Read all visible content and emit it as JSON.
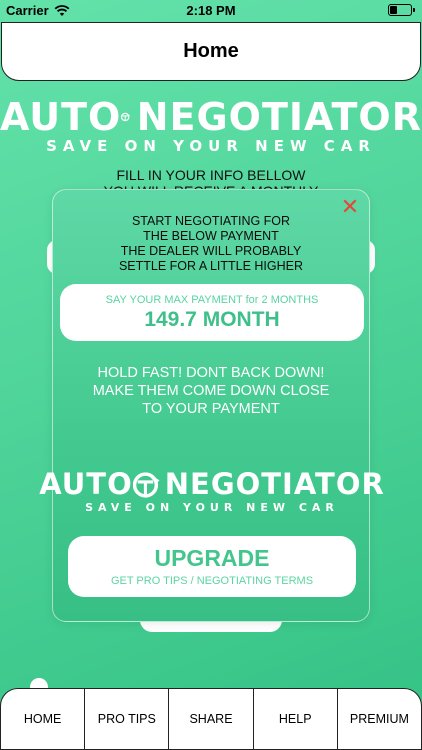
{
  "status_bar": {
    "carrier": "Carrier",
    "time": "2:18 PM"
  },
  "nav": {
    "title": "Home"
  },
  "logo": {
    "brand_part1": "AUTO",
    "brand_part2": "NEGOTIATOR",
    "tagline": "SAVE ON YOUR NEW CAR"
  },
  "background": {
    "line1": "FILL IN YOUR INFO BELLOW",
    "line2": "YOU WILL RECEIVE A MONTHLY"
  },
  "popup": {
    "close_label": "✕",
    "instructions": [
      "START NEGOTIATING FOR",
      "THE BELOW PAYMENT",
      "THE DEALER WILL PROBABLY",
      "SETTLE FOR A LITTLE HIGHER"
    ],
    "payment_label": "SAY YOUR MAX PAYMENT for 2 MONTHS",
    "payment_value": "149.7 MONTH",
    "hold_text": [
      "HOLD FAST! DONT BACK DOWN!",
      "MAKE THEM COME DOWN CLOSE",
      "TO YOUR PAYMENT"
    ],
    "upgrade_title": "UPGRADE",
    "upgrade_subtitle": "GET PRO TIPS / NEGOTIATING TERMS"
  },
  "tabs": [
    {
      "label": "HOME"
    },
    {
      "label": "PRO TIPS"
    },
    {
      "label": "SHARE"
    },
    {
      "label": "HELP"
    },
    {
      "label": "PREMIUM"
    }
  ],
  "colors": {
    "accent": "#44c58d",
    "background": "#4fd49a",
    "close": "#e04a3a"
  }
}
